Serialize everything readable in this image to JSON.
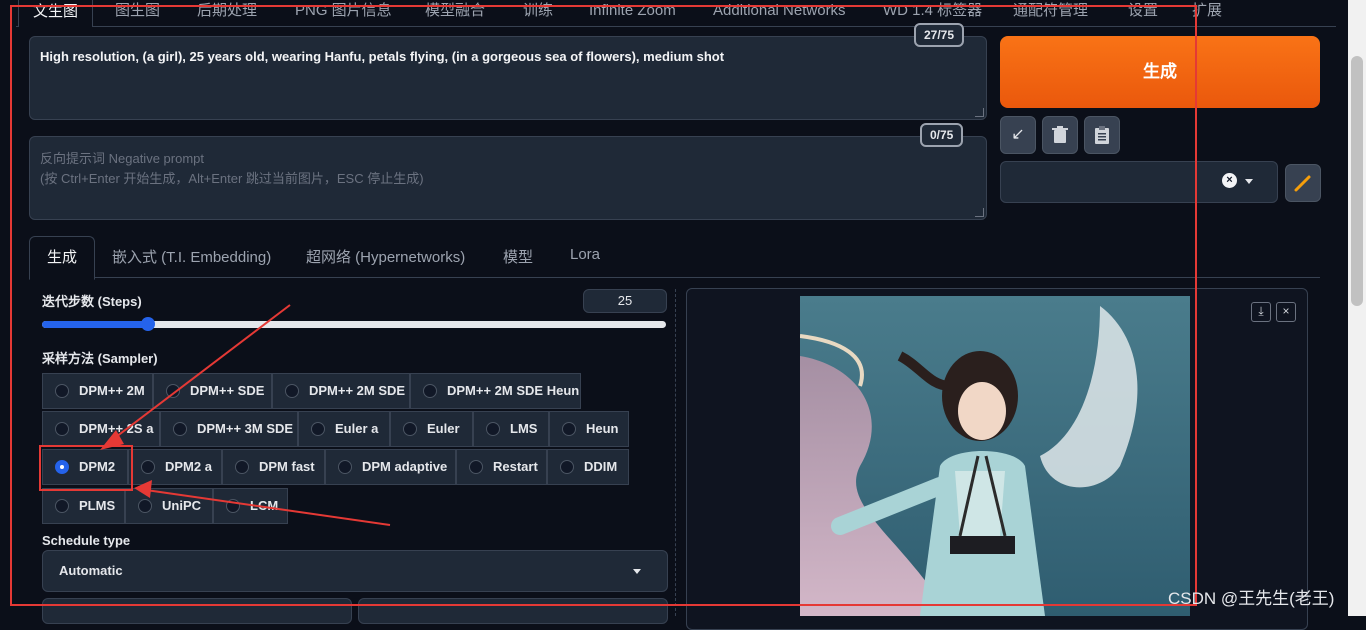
{
  "top_tabs": [
    {
      "label": "文生图",
      "active": true
    },
    {
      "label": "图生图"
    },
    {
      "label": "后期处理"
    },
    {
      "label": "PNG 图片信息"
    },
    {
      "label": "模型融合"
    },
    {
      "label": "训练"
    },
    {
      "label": "Infinite Zoom"
    },
    {
      "label": "Additional Networks"
    },
    {
      "label": "WD 1.4 标签器"
    },
    {
      "label": "通配符管理"
    },
    {
      "label": "设置"
    },
    {
      "label": "扩展"
    }
  ],
  "prompt": {
    "value": "High resolution, (a girl), 25 years old, wearing Hanfu, petals flying, (in a gorgeous sea of flowers), medium shot",
    "counter": "27/75"
  },
  "negative_prompt": {
    "placeholder_line1": "反向提示词 Negative prompt",
    "placeholder_line2": "(按 Ctrl+Enter 开始生成，Alt+Enter 跳过当前图片，ESC 停止生成)",
    "counter": "0/75"
  },
  "generate_label": "生成",
  "tool_buttons": [
    "arrow-icon",
    "trash-icon",
    "clipboard-icon"
  ],
  "sub_tabs": [
    "生成",
    "嵌入式 (T.I. Embedding)",
    "超网络 (Hypernetworks)",
    "模型",
    "Lora"
  ],
  "steps": {
    "label": "迭代步数 (Steps)",
    "value": "25",
    "fraction": 0.17
  },
  "sampler": {
    "label": "采样方法 (Sampler)",
    "selected": "DPM2",
    "rows": [
      [
        "DPM++ 2M",
        "DPM++ SDE",
        "DPM++ 2M SDE",
        "DPM++ 2M SDE Heun"
      ],
      [
        "DPM++ 2S a",
        "DPM++ 3M SDE",
        "Euler a",
        "Euler",
        "LMS",
        "Heun"
      ],
      [
        "DPM2",
        "DPM2 a",
        "DPM fast",
        "DPM adaptive",
        "Restart",
        "DDIM"
      ],
      [
        "PLMS",
        "UniPC",
        "LCM"
      ]
    ]
  },
  "schedule": {
    "label": "Schedule type",
    "value": "Automatic"
  },
  "watermark": "CSDN @王先生(老王)",
  "colors": {
    "accent": "#f97316",
    "highlight": "#e53935",
    "selected": "#2563eb"
  }
}
